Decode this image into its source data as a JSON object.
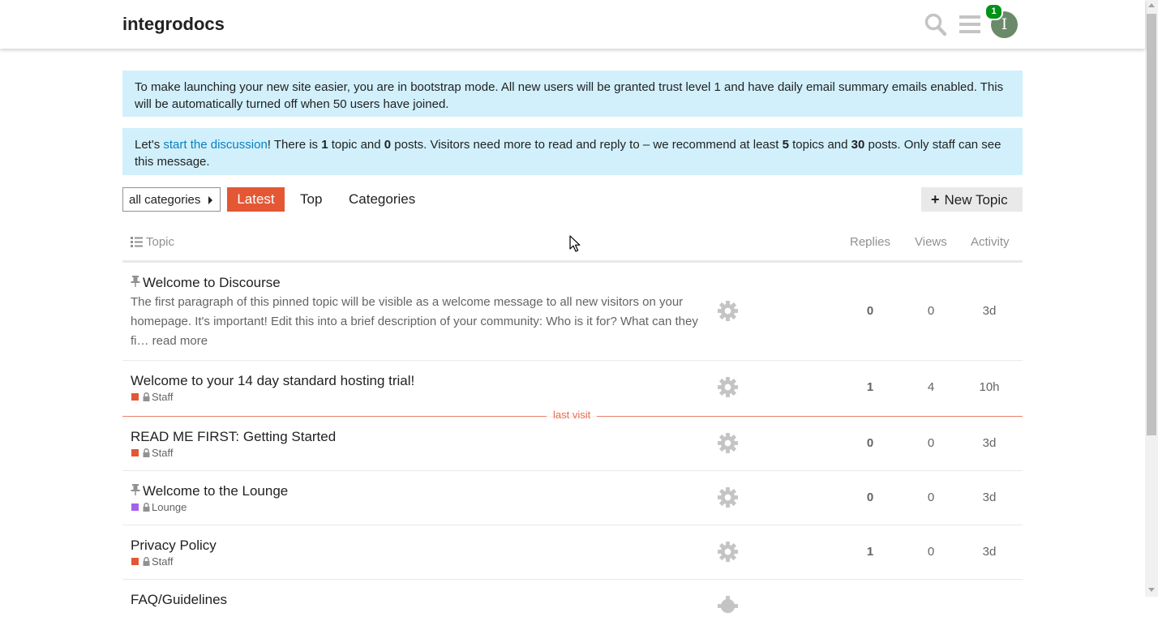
{
  "header": {
    "site_title": "integrodocs",
    "notification_count": "1",
    "avatar_letter": "I",
    "icons": [
      "search-icon",
      "hamburger-menu-icon",
      "avatar"
    ]
  },
  "alerts": {
    "bootstrap": "To make launching your new site easier, you are in bootstrap mode. All new users will be granted trust level 1 and have daily email summary emails enabled. This will be automatically turned off when 50 users have joined.",
    "discussion": {
      "p1": "Let's ",
      "link": "start the discussion",
      "p2": "! There is ",
      "topics": "1",
      "p3": " topic and ",
      "posts": "0",
      "p4": " posts. Visitors need more to read and reply to – we recommend at least ",
      "rec_topics": "5",
      "p5": " topics and ",
      "rec_posts": "30",
      "p6": " posts. Only staff can see this message."
    }
  },
  "nav": {
    "category_dropdown": "all categories",
    "latest": "Latest",
    "top": "Top",
    "categories": "Categories",
    "new_topic": "New Topic"
  },
  "table": {
    "headers": {
      "topic": "Topic",
      "replies": "Replies",
      "views": "Views",
      "activity": "Activity"
    },
    "last_visit": "last visit",
    "rows": [
      {
        "title": "Welcome to Discourse",
        "pinned": true,
        "excerpt": "The first paragraph of this pinned topic will be visible as a welcome message to all new visitors on your homepage. It's important! Edit this into a brief description of your community: Who is it for? What can they fi…",
        "read_more": "read more",
        "replies": "0",
        "views": "0",
        "activity": "3d"
      },
      {
        "title": "Welcome to your 14 day standard hosting trial!",
        "category": "Staff",
        "category_color": "#e45735",
        "replies": "1",
        "views": "4",
        "activity": "10h"
      },
      {
        "title": "READ ME FIRST: Getting Started",
        "category": "Staff",
        "category_color": "#e45735",
        "replies": "0",
        "views": "0",
        "activity": "3d"
      },
      {
        "title": "Welcome to the Lounge",
        "pinned": true,
        "category": "Lounge",
        "category_color": "#a461ef",
        "replies": "0",
        "views": "0",
        "activity": "3d"
      },
      {
        "title": "Privacy Policy",
        "category": "Staff",
        "category_color": "#e45735",
        "replies": "1",
        "views": "0",
        "activity": "3d"
      },
      {
        "title": "FAQ/Guidelines"
      }
    ]
  }
}
